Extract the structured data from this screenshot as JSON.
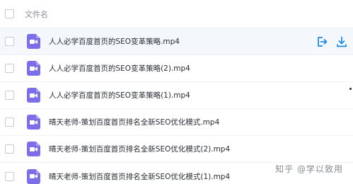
{
  "header": {
    "column_label": "文件名"
  },
  "files": [
    {
      "name": "人人必学百度首页的SEO变革策略.mp4",
      "icon": "video-file-icon"
    },
    {
      "name": "人人必学百度首页的SEO变革策略(2).mp4",
      "icon": "video-file-icon"
    },
    {
      "name": "人人必学百度首页的SEO变革策略(1).mp4",
      "icon": "video-file-icon"
    },
    {
      "name": "晴天老师-策划百度首页排名全新SEO优化模式.mp4",
      "icon": "video-file-icon"
    },
    {
      "name": "晴天老师-策划百度首页排名全新SEO优化模式(2).mp4",
      "icon": "video-file-icon"
    },
    {
      "name": "晴天老师-策划百度首页排名全新SEO优化模式(1).mp4",
      "icon": "video-file-icon"
    }
  ],
  "row_actions": {
    "share_icon": "share-icon",
    "download_icon": "download-icon"
  },
  "watermark": {
    "text": "知乎 @学以致用"
  },
  "colors": {
    "file_icon": "#7b6ee8",
    "action_icon": "#1e88e5",
    "hover_row": "#f4f8fd"
  }
}
